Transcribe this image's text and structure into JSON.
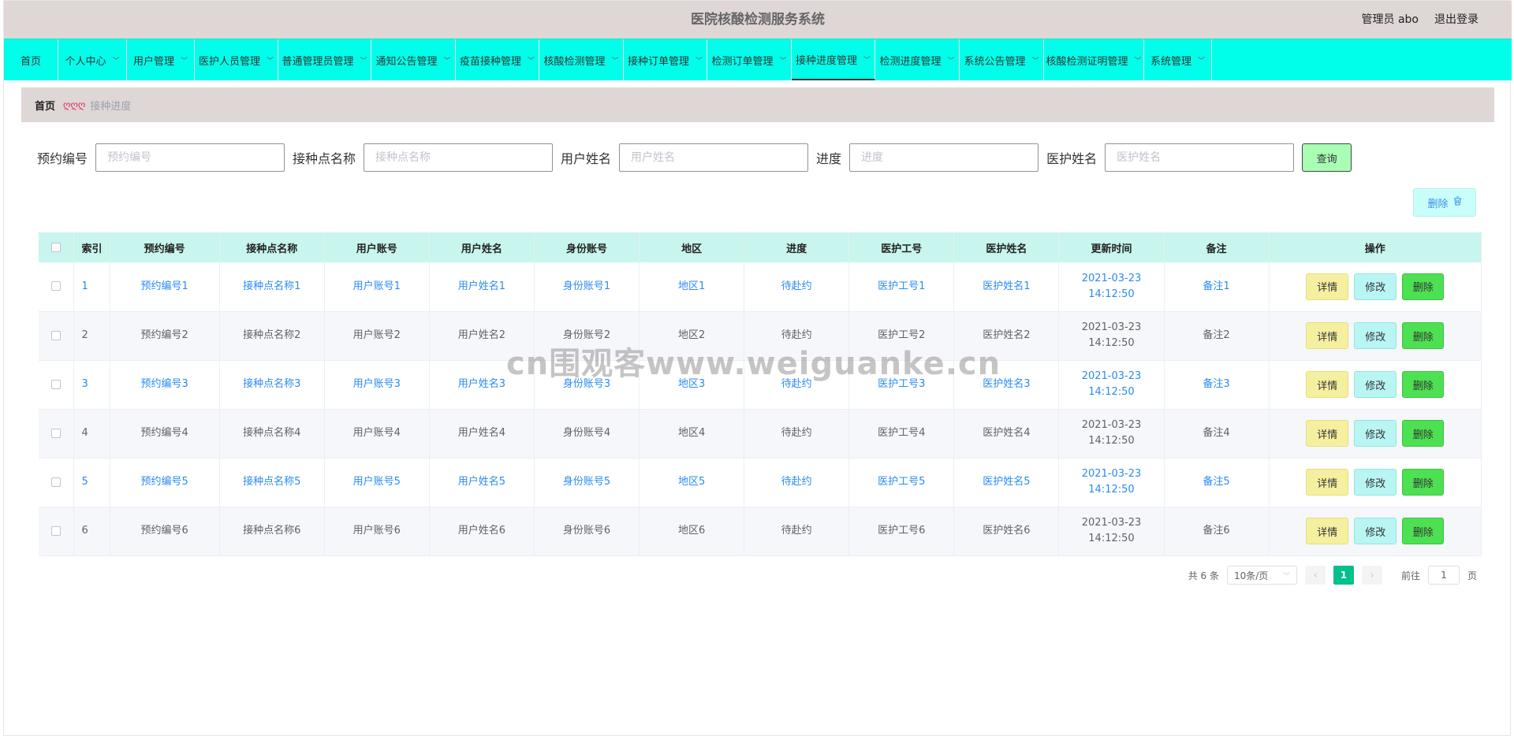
{
  "header": {
    "title": "医院核酸检测服务系统",
    "user": "管理员 abo",
    "logout": "退出登录"
  },
  "nav": {
    "items": [
      {
        "label": "首页",
        "dropdown": false
      },
      {
        "label": "个人中心",
        "dropdown": true
      },
      {
        "label": "用户管理",
        "dropdown": true
      },
      {
        "label": "医护人员管理",
        "dropdown": true
      },
      {
        "label": "普通管理员管理",
        "dropdown": true
      },
      {
        "label": "通知公告管理",
        "dropdown": true
      },
      {
        "label": "疫苗接种管理",
        "dropdown": true
      },
      {
        "label": "核酸检测管理",
        "dropdown": true
      },
      {
        "label": "接种订单管理",
        "dropdown": true
      },
      {
        "label": "检测订单管理",
        "dropdown": true
      },
      {
        "label": "接种进度管理",
        "dropdown": true,
        "active": true
      },
      {
        "label": "检测进度管理",
        "dropdown": true
      },
      {
        "label": "系统公告管理",
        "dropdown": true
      },
      {
        "label": "核酸检测证明管理",
        "dropdown": true
      },
      {
        "label": "系统管理",
        "dropdown": true
      }
    ]
  },
  "breadcrumb": {
    "home": "首页",
    "separator": "ღღღ",
    "current": "接种进度"
  },
  "search": {
    "fields": [
      {
        "label": "预约编号",
        "placeholder": "预约编号"
      },
      {
        "label": "接种点名称",
        "placeholder": "接种点名称"
      },
      {
        "label": "用户姓名",
        "placeholder": "用户姓名"
      },
      {
        "label": "进度",
        "placeholder": "进度"
      },
      {
        "label": "医护姓名",
        "placeholder": "医护姓名"
      }
    ],
    "query_label": "查询",
    "batch_delete_label": "删除"
  },
  "table": {
    "headers": [
      "索引",
      "预约编号",
      "接种点名称",
      "用户账号",
      "用户姓名",
      "身份账号",
      "地区",
      "进度",
      "医护工号",
      "医护姓名",
      "更新时间",
      "备注",
      "操作"
    ],
    "rows": [
      [
        "1",
        "预约编号1",
        "接种点名称1",
        "用户账号1",
        "用户姓名1",
        "身份账号1",
        "地区1",
        "待赴约",
        "医护工号1",
        "医护姓名1",
        "2021-03-23 14:12:50",
        "备注1"
      ],
      [
        "2",
        "预约编号2",
        "接种点名称2",
        "用户账号2",
        "用户姓名2",
        "身份账号2",
        "地区2",
        "待赴约",
        "医护工号2",
        "医护姓名2",
        "2021-03-23 14:12:50",
        "备注2"
      ],
      [
        "3",
        "预约编号3",
        "接种点名称3",
        "用户账号3",
        "用户姓名3",
        "身份账号3",
        "地区3",
        "待赴约",
        "医护工号3",
        "医护姓名3",
        "2021-03-23 14:12:50",
        "备注3"
      ],
      [
        "4",
        "预约编号4",
        "接种点名称4",
        "用户账号4",
        "用户姓名4",
        "身份账号4",
        "地区4",
        "待赴约",
        "医护工号4",
        "医护姓名4",
        "2021-03-23 14:12:50",
        "备注4"
      ],
      [
        "5",
        "预约编号5",
        "接种点名称5",
        "用户账号5",
        "用户姓名5",
        "身份账号5",
        "地区5",
        "待赴约",
        "医护工号5",
        "医护姓名5",
        "2021-03-23 14:12:50",
        "备注5"
      ],
      [
        "6",
        "预约编号6",
        "接种点名称6",
        "用户账号6",
        "用户姓名6",
        "身份账号6",
        "地区6",
        "待赴约",
        "医护工号6",
        "医护姓名6",
        "2021-03-23 14:12:50",
        "备注6"
      ]
    ],
    "actions": {
      "detail": "详情",
      "edit": "修改",
      "delete": "删除"
    }
  },
  "pager": {
    "total": "共 6 条",
    "page_size": "10条/页",
    "current_page": "1",
    "goto_label": "前往",
    "goto_value": "1",
    "page_unit": "页"
  },
  "watermark": "cn围观客www.weiguanke.cn",
  "colors": {
    "header_bg": "#dfd6d6",
    "nav_bg": "#00ffea",
    "table_header_bg": "#c8f5ee",
    "link_blue": "#2a8bf2",
    "pager_active": "#00c08b"
  }
}
